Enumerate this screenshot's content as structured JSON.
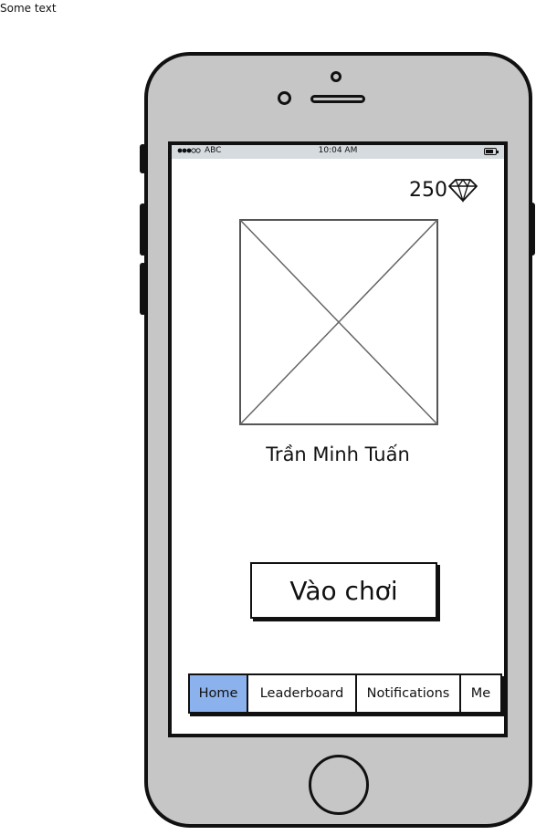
{
  "page": {
    "corner_text": "Some text"
  },
  "status_bar": {
    "carrier": "ABC",
    "time": "10:04 AM"
  },
  "header": {
    "gem_count": "250",
    "gem_icon": "diamond-icon"
  },
  "profile": {
    "avatar": "image-placeholder",
    "name": "Trần Minh Tuấn"
  },
  "actions": {
    "play_label": "Vào chơi"
  },
  "tabs": [
    {
      "label": "Home",
      "active": true
    },
    {
      "label": "Leaderboard",
      "active": false
    },
    {
      "label": "Notifications",
      "active": false
    },
    {
      "label": "Me",
      "active": false
    }
  ],
  "colors": {
    "active_tab": "#8cb2ed",
    "device_body": "#c6c6c6",
    "status_bar": "#d5dbde"
  }
}
